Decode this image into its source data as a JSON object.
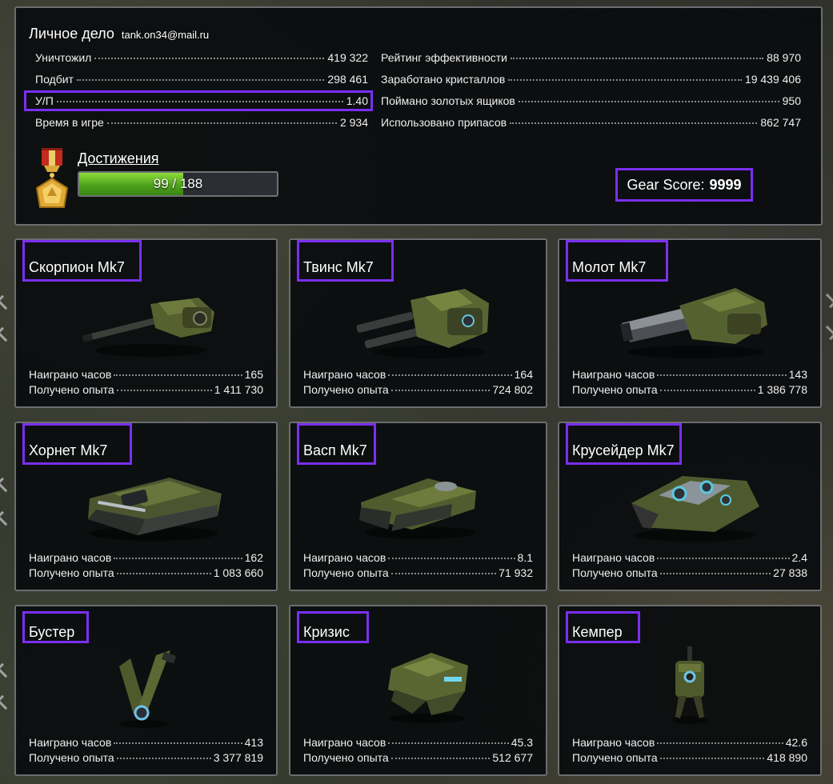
{
  "profile": {
    "title": "Личное дело",
    "email": "tank.on34@mail.ru",
    "left_stats": [
      {
        "label": "Уничтожил",
        "value": "419 322"
      },
      {
        "label": "Подбит",
        "value": "298 461"
      },
      {
        "label": "У/П",
        "value": "1.40"
      },
      {
        "label": "Время в игре",
        "value": "2 934"
      }
    ],
    "right_stats": [
      {
        "label": "Рейтинг эффективности",
        "value": "88 970"
      },
      {
        "label": "Заработано кристаллов",
        "value": "19 439 406"
      },
      {
        "label": "Поймано золотых ящиков",
        "value": "950"
      },
      {
        "label": "Использовано припасов",
        "value": "862 747"
      }
    ],
    "achievements": {
      "label": "Достижения",
      "progress_text": "99 / 188",
      "done": 99,
      "total": 188
    },
    "gear_score": {
      "label": "Gear Score:",
      "value": "9999"
    }
  },
  "item_labels": {
    "hours": "Наиграно часов",
    "xp": "Получено опыта"
  },
  "items": [
    {
      "name": "Скорпион Mk7",
      "icon": "scorpion-turret-icon",
      "hours": "165",
      "xp": "1 411 730"
    },
    {
      "name": "Твинс Mk7",
      "icon": "twins-turret-icon",
      "hours": "164",
      "xp": "724 802"
    },
    {
      "name": "Молот Mk7",
      "icon": "hammer-turret-icon",
      "hours": "143",
      "xp": "1 386 778"
    },
    {
      "name": "Хорнет Mk7",
      "icon": "hornet-hull-icon",
      "hours": "162",
      "xp": "1 083 660"
    },
    {
      "name": "Васп Mk7",
      "icon": "wasp-hull-icon",
      "hours": "8.1",
      "xp": "71 932"
    },
    {
      "name": "Крусейдер Mk7",
      "icon": "crusader-hull-icon",
      "hours": "2.4",
      "xp": "27 838"
    },
    {
      "name": "Бустер",
      "icon": "booster-drone-icon",
      "hours": "413",
      "xp": "3 377 819"
    },
    {
      "name": "Кризис",
      "icon": "crisis-drone-icon",
      "hours": "45.3",
      "xp": "512 677"
    },
    {
      "name": "Кемпер",
      "icon": "camper-drone-icon",
      "hours": "42.6",
      "xp": "418 890"
    }
  ],
  "colors": {
    "highlight": "#7a2ff0",
    "progress": "#6fc32b",
    "panel_border": "#6b6d70"
  }
}
